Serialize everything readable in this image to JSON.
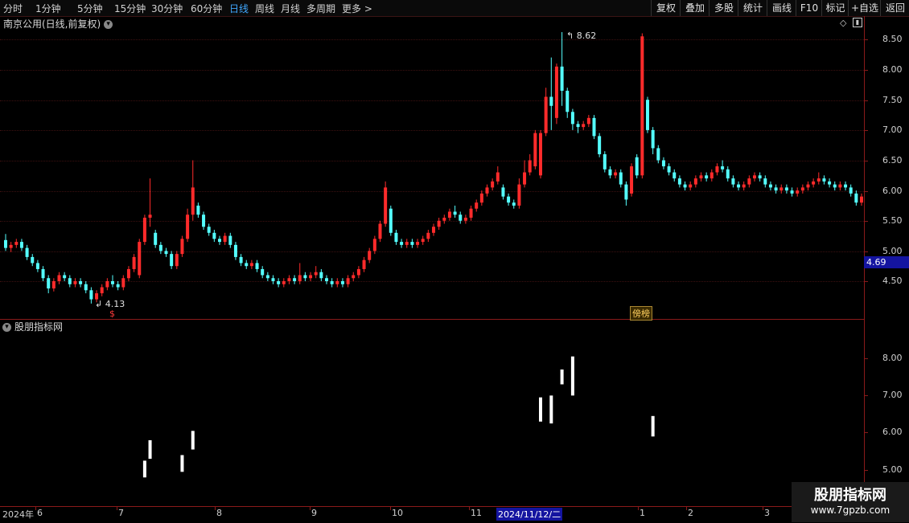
{
  "toolbar": {
    "periods": [
      "分时",
      "1分钟",
      "5分钟",
      "15分钟",
      "30分钟",
      "60分钟",
      "日线",
      "周线",
      "月线",
      "多周期",
      "更多 >"
    ],
    "active_period": "日线",
    "buttons": [
      "复权",
      "叠加",
      "多股",
      "统计",
      "画线",
      "F10",
      "标记",
      "+自选",
      "返回"
    ]
  },
  "header": {
    "title": "南京公用(日线,前复权)"
  },
  "indicator": {
    "title": "股朋指标网"
  },
  "price_axis": [
    "8.50",
    "8.00",
    "7.50",
    "7.00",
    "6.50",
    "6.00",
    "5.50",
    "5.00",
    "4.50"
  ],
  "current_price": "4.69",
  "sub_axis": [
    "8.00",
    "7.00",
    "6.00",
    "5.00"
  ],
  "annotations": {
    "high": "8.62",
    "low": "4.13",
    "marker": "$",
    "badge": "榜"
  },
  "x_axis": {
    "labels": [
      "2024年",
      "6",
      "7",
      "8",
      "9",
      "10",
      "11",
      "2024/11/12/二",
      "1",
      "2",
      "3"
    ],
    "highlight": "2024/11/12/二"
  },
  "watermark": {
    "line1": "股朋指标网",
    "line2": "www.7gpzb.com"
  },
  "colors": {
    "up": "#ff2b2b",
    "down": "#54ffff",
    "signal": "#ffffff",
    "axis": "#8a1a1a",
    "active": "#40a8ff"
  },
  "chart_data": {
    "type": "candlestick",
    "title": "南京公用(日线,前复权)",
    "y_range": [
      4.0,
      8.7
    ],
    "high_marker": 8.62,
    "low_marker": 4.13,
    "last_price": 4.69,
    "candles": [
      [
        5.18,
        5.05,
        5.28,
        5.0
      ],
      [
        5.05,
        5.1,
        5.15,
        4.98
      ],
      [
        5.1,
        5.15,
        5.2,
        5.05
      ],
      [
        5.15,
        5.05,
        5.2,
        5.0
      ],
      [
        5.05,
        4.9,
        5.1,
        4.85
      ],
      [
        4.9,
        4.8,
        4.95,
        4.75
      ],
      [
        4.8,
        4.7,
        4.85,
        4.65
      ],
      [
        4.7,
        4.55,
        4.75,
        4.5
      ],
      [
        4.55,
        4.38,
        4.6,
        4.3
      ],
      [
        4.38,
        4.5,
        4.55,
        4.33
      ],
      [
        4.5,
        4.6,
        4.65,
        4.45
      ],
      [
        4.6,
        4.55,
        4.65,
        4.5
      ],
      [
        4.55,
        4.45,
        4.6,
        4.4
      ],
      [
        4.45,
        4.5,
        4.55,
        4.4
      ],
      [
        4.5,
        4.45,
        4.55,
        4.4
      ],
      [
        4.45,
        4.35,
        4.5,
        4.3
      ],
      [
        4.35,
        4.2,
        4.4,
        4.13
      ],
      [
        4.2,
        4.3,
        4.35,
        4.15
      ],
      [
        4.3,
        4.4,
        4.45,
        4.25
      ],
      [
        4.4,
        4.5,
        4.55,
        4.35
      ],
      [
        4.5,
        4.45,
        4.6,
        4.4
      ],
      [
        4.45,
        4.4,
        4.5,
        4.35
      ],
      [
        4.4,
        4.55,
        4.6,
        4.35
      ],
      [
        4.55,
        4.7,
        4.75,
        4.5
      ],
      [
        4.7,
        4.9,
        4.95,
        4.65
      ],
      [
        4.6,
        5.15,
        5.2,
        4.55
      ],
      [
        5.15,
        5.55,
        5.6,
        5.1
      ],
      [
        5.55,
        5.6,
        6.2,
        5.4
      ],
      [
        5.3,
        5.1,
        5.35,
        5.05
      ],
      [
        5.1,
        5.0,
        5.15,
        4.95
      ],
      [
        5.0,
        4.95,
        5.05,
        4.9
      ],
      [
        4.95,
        4.75,
        5.0,
        4.7
      ],
      [
        4.75,
        4.95,
        5.0,
        4.7
      ],
      [
        4.95,
        5.2,
        5.25,
        4.9
      ],
      [
        5.2,
        5.6,
        5.7,
        5.15
      ],
      [
        5.6,
        6.05,
        6.5,
        5.5
      ],
      [
        5.75,
        5.6,
        5.8,
        5.55
      ],
      [
        5.6,
        5.4,
        5.65,
        5.35
      ],
      [
        5.4,
        5.3,
        5.45,
        5.25
      ],
      [
        5.3,
        5.2,
        5.35,
        5.15
      ],
      [
        5.2,
        5.15,
        5.25,
        5.1
      ],
      [
        5.15,
        5.25,
        5.3,
        5.1
      ],
      [
        5.25,
        5.1,
        5.3,
        5.05
      ],
      [
        5.1,
        4.9,
        5.15,
        4.85
      ],
      [
        4.9,
        4.8,
        4.95,
        4.75
      ],
      [
        4.8,
        4.75,
        4.85,
        4.7
      ],
      [
        4.75,
        4.8,
        4.85,
        4.7
      ],
      [
        4.8,
        4.7,
        4.85,
        4.65
      ],
      [
        4.7,
        4.6,
        4.75,
        4.55
      ],
      [
        4.6,
        4.55,
        4.65,
        4.5
      ],
      [
        4.55,
        4.5,
        4.6,
        4.45
      ],
      [
        4.5,
        4.45,
        4.55,
        4.4
      ],
      [
        4.45,
        4.5,
        4.55,
        4.4
      ],
      [
        4.5,
        4.55,
        4.6,
        4.45
      ],
      [
        4.55,
        4.5,
        4.6,
        4.45
      ],
      [
        4.5,
        4.6,
        4.8,
        4.45
      ],
      [
        4.6,
        4.55,
        4.65,
        4.5
      ],
      [
        4.55,
        4.6,
        4.65,
        4.5
      ],
      [
        4.6,
        4.65,
        4.75,
        4.55
      ],
      [
        4.65,
        4.55,
        4.7,
        4.5
      ],
      [
        4.55,
        4.5,
        4.6,
        4.45
      ],
      [
        4.5,
        4.45,
        4.55,
        4.4
      ],
      [
        4.45,
        4.5,
        4.55,
        4.4
      ],
      [
        4.5,
        4.45,
        4.55,
        4.4
      ],
      [
        4.45,
        4.55,
        4.6,
        4.4
      ],
      [
        4.55,
        4.6,
        4.65,
        4.5
      ],
      [
        4.6,
        4.7,
        4.75,
        4.55
      ],
      [
        4.7,
        4.85,
        4.9,
        4.65
      ],
      [
        4.85,
        5.0,
        5.05,
        4.8
      ],
      [
        5.0,
        5.2,
        5.25,
        4.95
      ],
      [
        5.2,
        5.45,
        5.5,
        5.15
      ],
      [
        5.45,
        6.05,
        6.15,
        5.4
      ],
      [
        5.7,
        5.3,
        5.75,
        5.25
      ],
      [
        5.3,
        5.15,
        5.35,
        5.1
      ],
      [
        5.15,
        5.1,
        5.2,
        5.05
      ],
      [
        5.1,
        5.15,
        5.2,
        5.05
      ],
      [
        5.15,
        5.1,
        5.2,
        5.05
      ],
      [
        5.1,
        5.15,
        5.2,
        5.05
      ],
      [
        5.15,
        5.2,
        5.25,
        5.1
      ],
      [
        5.2,
        5.3,
        5.35,
        5.15
      ],
      [
        5.3,
        5.4,
        5.45,
        5.25
      ],
      [
        5.4,
        5.5,
        5.55,
        5.35
      ],
      [
        5.5,
        5.55,
        5.6,
        5.45
      ],
      [
        5.55,
        5.65,
        5.7,
        5.5
      ],
      [
        5.65,
        5.6,
        5.75,
        5.55
      ],
      [
        5.6,
        5.5,
        5.65,
        5.45
      ],
      [
        5.5,
        5.55,
        5.6,
        5.45
      ],
      [
        5.55,
        5.7,
        5.75,
        5.5
      ],
      [
        5.7,
        5.8,
        5.85,
        5.65
      ],
      [
        5.8,
        5.95,
        6.0,
        5.75
      ],
      [
        5.95,
        6.05,
        6.1,
        5.9
      ],
      [
        6.05,
        6.15,
        6.2,
        6.0
      ],
      [
        6.15,
        6.3,
        6.4,
        6.1
      ],
      [
        6.05,
        5.9,
        6.1,
        5.85
      ],
      [
        5.9,
        5.8,
        5.95,
        5.75
      ],
      [
        5.8,
        5.75,
        5.85,
        5.7
      ],
      [
        5.75,
        6.1,
        6.2,
        5.7
      ],
      [
        6.1,
        6.3,
        6.5,
        6.05
      ],
      [
        6.3,
        6.5,
        6.6,
        6.25
      ],
      [
        6.4,
        6.95,
        7.0,
        6.35
      ],
      [
        6.25,
        6.95,
        7.0,
        6.2
      ],
      [
        6.95,
        7.55,
        7.7,
        6.9
      ],
      [
        7.55,
        7.4,
        8.2,
        7.0
      ],
      [
        7.2,
        8.05,
        8.1,
        7.1
      ],
      [
        8.05,
        7.65,
        8.62,
        7.4
      ],
      [
        7.65,
        7.3,
        7.7,
        7.2
      ],
      [
        7.3,
        7.1,
        7.35,
        7.0
      ],
      [
        7.1,
        7.05,
        7.15,
        6.95
      ],
      [
        7.05,
        7.1,
        7.15,
        7.0
      ],
      [
        7.1,
        7.2,
        7.25,
        7.05
      ],
      [
        7.2,
        6.9,
        7.25,
        6.85
      ],
      [
        6.9,
        6.6,
        6.95,
        6.55
      ],
      [
        6.6,
        6.35,
        6.65,
        6.3
      ],
      [
        6.35,
        6.25,
        6.4,
        6.2
      ],
      [
        6.25,
        6.3,
        6.35,
        6.2
      ],
      [
        6.3,
        6.1,
        6.35,
        6.05
      ],
      [
        6.1,
        5.85,
        6.15,
        5.75
      ],
      [
        5.95,
        6.4,
        6.45,
        5.9
      ],
      [
        6.55,
        6.25,
        6.6,
        6.2
      ],
      [
        6.25,
        8.55,
        8.6,
        6.2
      ],
      [
        7.5,
        7.0,
        7.55,
        6.95
      ],
      [
        7.0,
        6.7,
        7.05,
        6.6
      ],
      [
        6.7,
        6.5,
        6.75,
        6.45
      ],
      [
        6.5,
        6.4,
        6.55,
        6.35
      ],
      [
        6.4,
        6.3,
        6.45,
        6.25
      ],
      [
        6.3,
        6.2,
        6.35,
        6.15
      ],
      [
        6.2,
        6.1,
        6.25,
        6.05
      ],
      [
        6.1,
        6.05,
        6.15,
        6.0
      ],
      [
        6.05,
        6.1,
        6.15,
        6.0
      ],
      [
        6.1,
        6.2,
        6.25,
        6.05
      ],
      [
        6.2,
        6.25,
        6.3,
        6.15
      ],
      [
        6.25,
        6.2,
        6.3,
        6.15
      ],
      [
        6.2,
        6.3,
        6.35,
        6.15
      ],
      [
        6.3,
        6.4,
        6.45,
        6.25
      ],
      [
        6.4,
        6.35,
        6.5,
        6.3
      ],
      [
        6.35,
        6.2,
        6.4,
        6.15
      ],
      [
        6.2,
        6.1,
        6.25,
        6.05
      ],
      [
        6.1,
        6.05,
        6.15,
        6.0
      ],
      [
        6.05,
        6.1,
        6.15,
        6.0
      ],
      [
        6.1,
        6.2,
        6.25,
        6.05
      ],
      [
        6.2,
        6.25,
        6.3,
        6.15
      ],
      [
        6.25,
        6.2,
        6.3,
        6.15
      ],
      [
        6.2,
        6.1,
        6.25,
        6.05
      ],
      [
        6.1,
        6.05,
        6.15,
        6.0
      ],
      [
        6.05,
        6.0,
        6.1,
        5.95
      ],
      [
        6.0,
        6.05,
        6.1,
        5.95
      ],
      [
        6.05,
        6.0,
        6.1,
        5.95
      ],
      [
        6.0,
        5.95,
        6.05,
        5.9
      ],
      [
        5.95,
        6.0,
        6.05,
        5.9
      ],
      [
        6.0,
        6.05,
        6.1,
        5.95
      ],
      [
        6.05,
        6.1,
        6.15,
        6.0
      ],
      [
        6.1,
        6.15,
        6.2,
        6.05
      ],
      [
        6.15,
        6.2,
        6.3,
        6.1
      ],
      [
        6.2,
        6.15,
        6.25,
        6.1
      ],
      [
        6.15,
        6.1,
        6.2,
        6.05
      ],
      [
        6.1,
        6.05,
        6.15,
        6.0
      ],
      [
        6.05,
        6.1,
        6.15,
        6.0
      ],
      [
        6.1,
        6.05,
        6.15,
        6.0
      ],
      [
        6.05,
        5.95,
        6.1,
        5.9
      ],
      [
        5.95,
        5.8,
        6.0,
        5.75
      ],
      [
        5.8,
        5.9,
        5.95,
        5.75
      ],
      [
        5.9,
        6.0,
        6.05,
        5.85
      ]
    ],
    "signals": [
      {
        "index": 26,
        "low": 4.8,
        "high": 5.25
      },
      {
        "index": 27,
        "low": 5.3,
        "high": 5.8
      },
      {
        "index": 33,
        "low": 4.95,
        "high": 5.4
      },
      {
        "index": 35,
        "low": 5.55,
        "high": 6.05
      },
      {
        "index": 100,
        "low": 6.3,
        "high": 6.95
      },
      {
        "index": 102,
        "low": 6.25,
        "high": 7.0
      },
      {
        "index": 104,
        "low": 7.3,
        "high": 7.7
      },
      {
        "index": 106,
        "low": 7.0,
        "high": 8.05
      },
      {
        "index": 121,
        "low": 5.9,
        "high": 6.45
      }
    ]
  }
}
